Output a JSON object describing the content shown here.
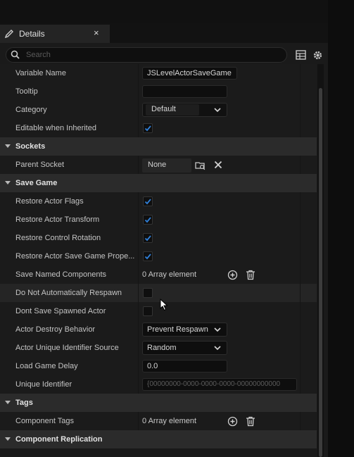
{
  "tab": {
    "title": "Details",
    "close": "×"
  },
  "search": {
    "placeholder": "Search"
  },
  "rows": {
    "variable_name": {
      "label": "Variable Name",
      "value": "JSLevelActorSaveGame"
    },
    "tooltip": {
      "label": "Tooltip",
      "value": ""
    },
    "category": {
      "label": "Category",
      "value": "Default"
    },
    "editable_inherited": {
      "label": "Editable when Inherited",
      "checked": true
    },
    "sockets_header": {
      "label": "Sockets"
    },
    "parent_socket": {
      "label": "Parent Socket",
      "value": "None"
    },
    "save_game_header": {
      "label": "Save Game"
    },
    "restore_actor_flags": {
      "label": "Restore Actor Flags",
      "checked": true
    },
    "restore_actor_transform": {
      "label": "Restore Actor Transform",
      "checked": true
    },
    "restore_control_rotation": {
      "label": "Restore Control Rotation",
      "checked": true
    },
    "restore_actor_save_game": {
      "label": "Restore Actor Save Game Prope...",
      "checked": true
    },
    "save_named_components": {
      "label": "Save Named Components",
      "value": "0 Array element"
    },
    "do_not_respawn": {
      "label": "Do Not Automatically Respawn",
      "checked": false
    },
    "dont_save_spawned": {
      "label": "Dont Save Spawned Actor",
      "checked": false
    },
    "actor_destroy_behavior": {
      "label": "Actor Destroy Behavior",
      "value": "Prevent Respawn"
    },
    "actor_unique_id_source": {
      "label": "Actor Unique Identifier Source",
      "value": "Random"
    },
    "load_game_delay": {
      "label": "Load Game Delay",
      "value": "0.0"
    },
    "unique_identifier": {
      "label": "Unique Identifier",
      "value": "{00000000-0000-0000-0000-00000000000"
    },
    "tags_header": {
      "label": "Tags"
    },
    "component_tags": {
      "label": "Component Tags",
      "value": "0 Array element"
    },
    "component_replication_header": {
      "label": "Component Replication"
    }
  },
  "colors": {
    "accent_check": "#2f7fd8",
    "panel_bg": "#1b1b1b",
    "category_bg": "#2b2b2b"
  },
  "icons": [
    "pencil-icon",
    "close-icon",
    "search-icon",
    "table-view-icon",
    "settings-gear-icon",
    "chevron-down-icon",
    "browse-socket-icon",
    "clear-x-icon",
    "add-element-icon",
    "trash-icon",
    "mouse-cursor"
  ]
}
